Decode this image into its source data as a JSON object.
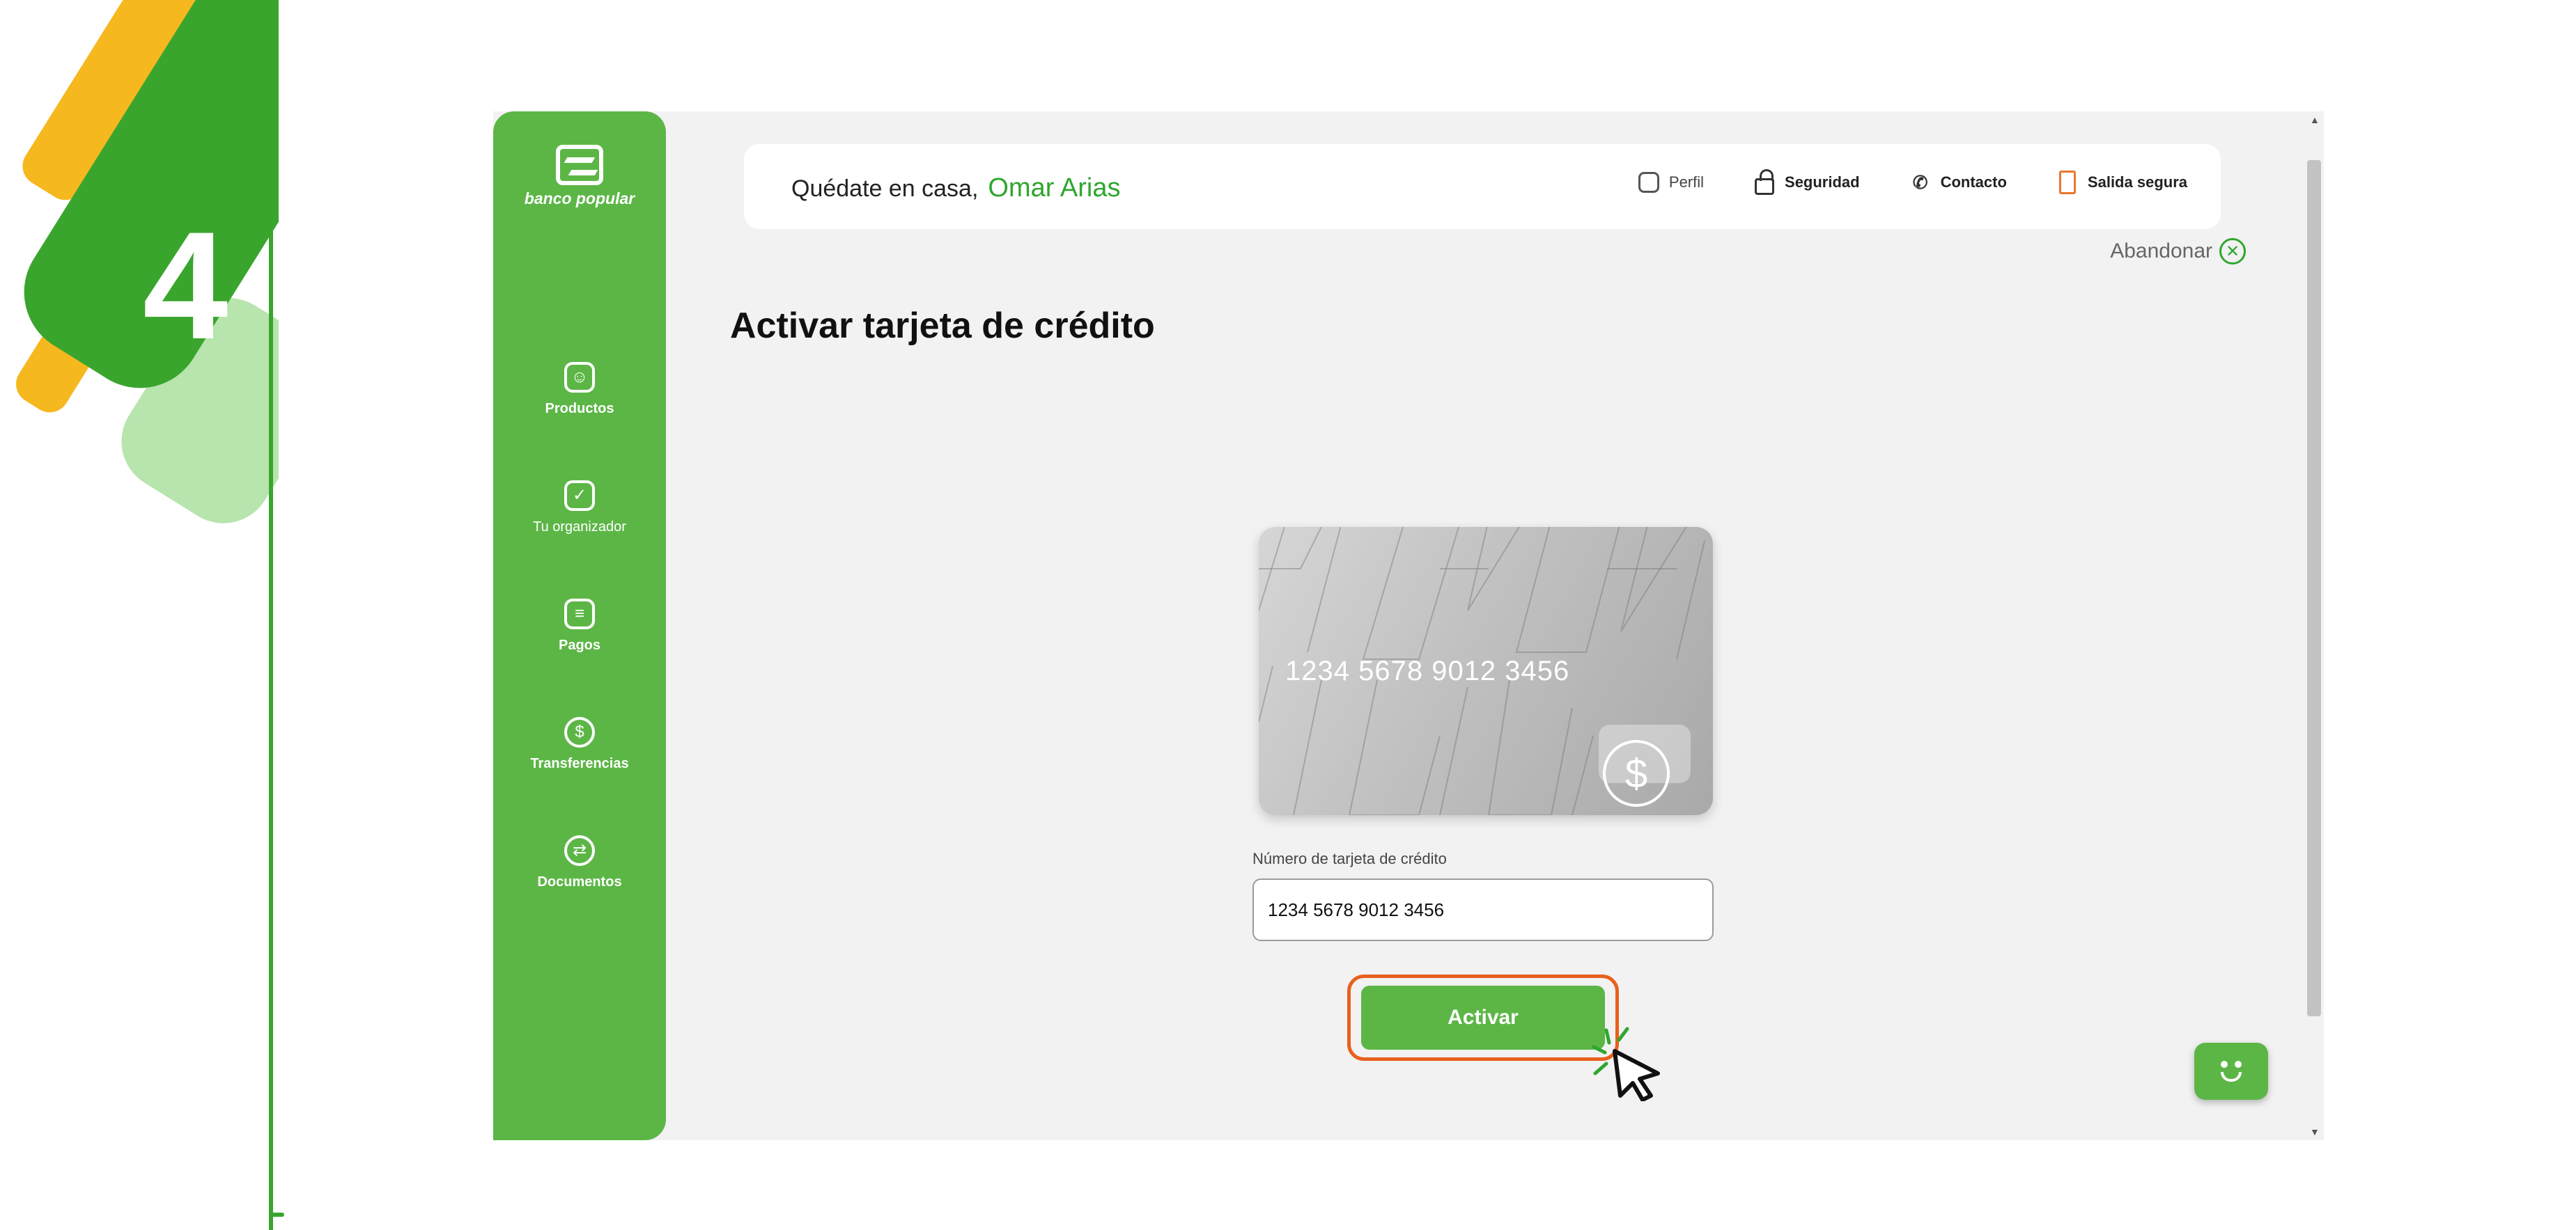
{
  "step_number": "4",
  "colors": {
    "brand_green": "#5cb646",
    "accent_green": "#2fa62f",
    "highlight_orange": "#e8601c",
    "badge_yellow": "#f6b81f"
  },
  "logo": {
    "text": "banco popular"
  },
  "sidebar": {
    "items": [
      {
        "label": "Productos",
        "icon": "home-smile-icon"
      },
      {
        "label": "Tu organizador",
        "icon": "wallet-icon"
      },
      {
        "label": "Pagos",
        "icon": "receipt-icon"
      },
      {
        "label": "Transferencias",
        "icon": "dollar-circle-icon"
      },
      {
        "label": "Documentos",
        "icon": "exchange-icon"
      }
    ]
  },
  "header": {
    "greeting": "Quédate en casa,",
    "user_name": "Omar Arias",
    "links": [
      {
        "label": "Perfil",
        "icon": "profile-icon"
      },
      {
        "label": "Seguridad",
        "icon": "lock-icon"
      },
      {
        "label": "Contacto",
        "icon": "phone-icon"
      },
      {
        "label": "Salida segura",
        "icon": "exit-door-icon"
      }
    ],
    "abandon_label": "Abandonar"
  },
  "main": {
    "title": "Activar tarjeta de crédito",
    "card_number_display": "1234 5678 9012 3456",
    "field_label": "Número de tarjeta de crédito",
    "field_value": "1234 5678 9012 3456",
    "button_label": "Activar"
  }
}
